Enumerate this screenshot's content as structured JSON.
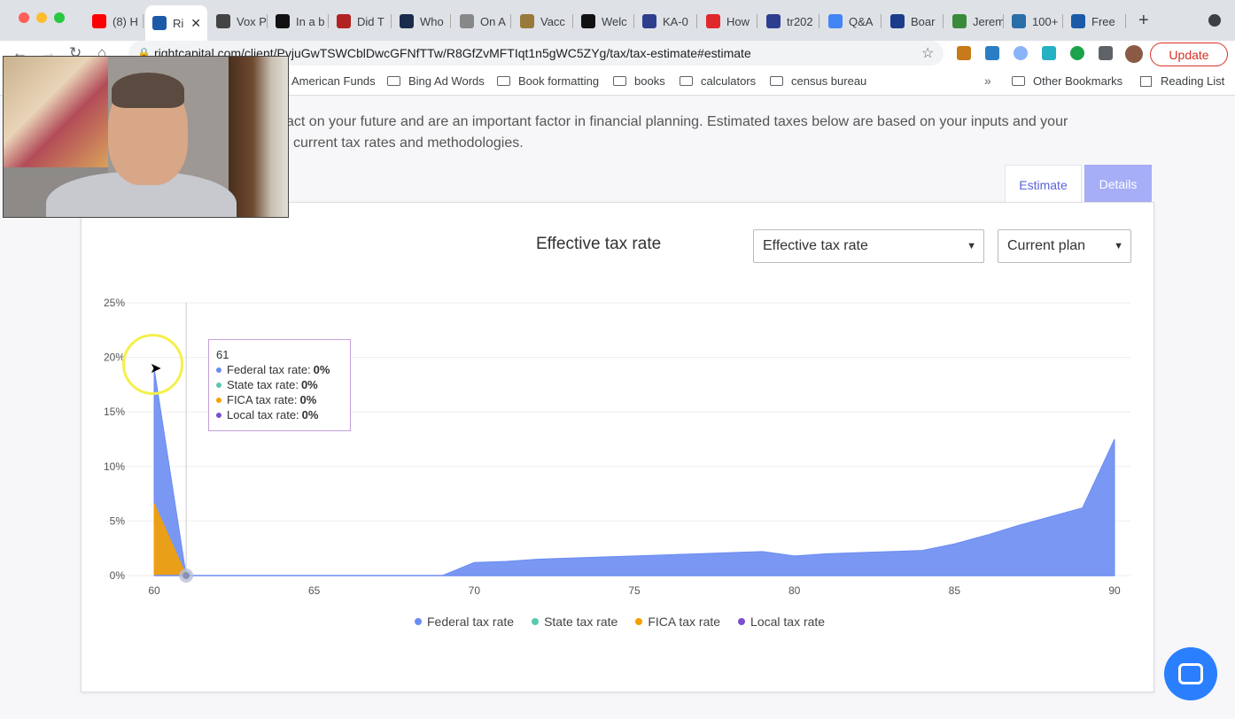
{
  "browser": {
    "tabs": [
      {
        "label": "(8) H",
        "fav": "#ff0000"
      },
      {
        "label": "Ri",
        "fav": "#1c5aa8",
        "active": true
      },
      {
        "label": "Vox P",
        "fav": "#444444"
      },
      {
        "label": "In a b",
        "fav": "#111111"
      },
      {
        "label": "Did T",
        "fav": "#b22222"
      },
      {
        "label": "Who",
        "fav": "#1a2b4c"
      },
      {
        "label": "On A",
        "fav": "#888888"
      },
      {
        "label": "Vacc",
        "fav": "#9a7a3a"
      },
      {
        "label": "Welc",
        "fav": "#111111"
      },
      {
        "label": "KA-0",
        "fav": "#2d3e8f"
      },
      {
        "label": "How",
        "fav": "#e0282a"
      },
      {
        "label": "tr202",
        "fav": "#2d3e8f"
      },
      {
        "label": "Q&A",
        "fav": "#4285f4"
      },
      {
        "label": "Boar",
        "fav": "#1a3c8a"
      },
      {
        "label": "Jerem",
        "fav": "#3b8a3b"
      },
      {
        "label": "100+",
        "fav": "#2a6ea8"
      },
      {
        "label": "Free",
        "fav": "#1a5aa8"
      }
    ],
    "url": "rightcapital.com/client/PyjuGwTSWCblDwcGFNfTTw/R8GfZvMFTIqt1n5gWC5ZYg/tax/tax-estimate#estimate",
    "update_label": "Update",
    "bookmarks": [
      "American Funds",
      "Bing Ad Words",
      "Book formatting",
      "books",
      "calculators",
      "census bureau"
    ],
    "overflow_label": "»",
    "other_bookmarks": "Other Bookmarks",
    "reading_list": "Reading List"
  },
  "page": {
    "intro_line1": "act on your future and are an important factor in financial planning. Estimated taxes below are based on your inputs and your",
    "intro_line2": "current tax rates and methodologies.",
    "tabs": {
      "estimate": "Estimate",
      "details": "Details"
    },
    "chart_title": "Effective tax rate",
    "metric_select": "Effective tax rate",
    "plan_select": "Current plan"
  },
  "tooltip": {
    "age": "61",
    "rows": [
      {
        "label": "Federal tax rate:",
        "value": "0%",
        "color": "#6b8df2"
      },
      {
        "label": "State tax rate:",
        "value": "0%",
        "color": "#5bc9b0"
      },
      {
        "label": "FICA tax rate:",
        "value": "0%",
        "color": "#f5a000"
      },
      {
        "label": "Local tax rate:",
        "value": "0%",
        "color": "#7a4fd0"
      }
    ]
  },
  "colors": {
    "federal": "#6b8df2",
    "state": "#5bc9b0",
    "fica": "#f5a000",
    "local": "#7a4fd0",
    "accent": "#5a63d8"
  },
  "chart_data": {
    "type": "area",
    "title": "Effective tax rate",
    "xlabel": "",
    "ylabel": "",
    "x_ticks": [
      60,
      65,
      70,
      75,
      80,
      85,
      90
    ],
    "y_ticks": [
      "0%",
      "5%",
      "10%",
      "15%",
      "20%",
      "25%"
    ],
    "xlim": [
      60,
      90
    ],
    "ylim": [
      0,
      25
    ],
    "legend_position": "bottom",
    "x": [
      60,
      61,
      62,
      63,
      64,
      65,
      66,
      67,
      68,
      69,
      70,
      71,
      72,
      73,
      74,
      75,
      76,
      77,
      78,
      79,
      80,
      81,
      82,
      83,
      84,
      85,
      86,
      87,
      88,
      89,
      90
    ],
    "series": [
      {
        "name": "Federal tax rate",
        "color": "#6b8df2",
        "values": [
          19.0,
          0,
          0,
          0,
          0,
          0,
          0,
          0,
          0,
          0,
          1.2,
          1.3,
          1.5,
          1.6,
          1.7,
          1.8,
          1.9,
          2.0,
          2.1,
          2.2,
          1.8,
          2.0,
          2.1,
          2.2,
          2.3,
          2.9,
          3.7,
          4.6,
          5.4,
          6.2,
          12.5
        ]
      },
      {
        "name": "State tax rate",
        "color": "#5bc9b0",
        "values": [
          0,
          0,
          0,
          0,
          0,
          0,
          0,
          0,
          0,
          0,
          0,
          0,
          0,
          0,
          0,
          0,
          0,
          0,
          0,
          0,
          0,
          0,
          0,
          0,
          0,
          0,
          0,
          0,
          0,
          0,
          0
        ]
      },
      {
        "name": "FICA tax rate",
        "color": "#f5a000",
        "values": [
          6.6,
          0,
          0,
          0,
          0,
          0,
          0,
          0,
          0,
          0,
          0,
          0,
          0,
          0,
          0,
          0,
          0,
          0,
          0,
          0,
          0,
          0,
          0,
          0,
          0,
          0,
          0,
          0,
          0,
          0,
          0
        ]
      },
      {
        "name": "Local tax rate",
        "color": "#7a4fd0",
        "values": [
          0,
          0,
          0,
          0,
          0,
          0,
          0,
          0,
          0,
          0,
          0,
          0,
          0,
          0,
          0,
          0,
          0,
          0,
          0,
          0,
          0,
          0,
          0,
          0,
          0,
          0,
          0,
          0,
          0,
          0,
          0
        ]
      }
    ],
    "hover_x": 61
  }
}
